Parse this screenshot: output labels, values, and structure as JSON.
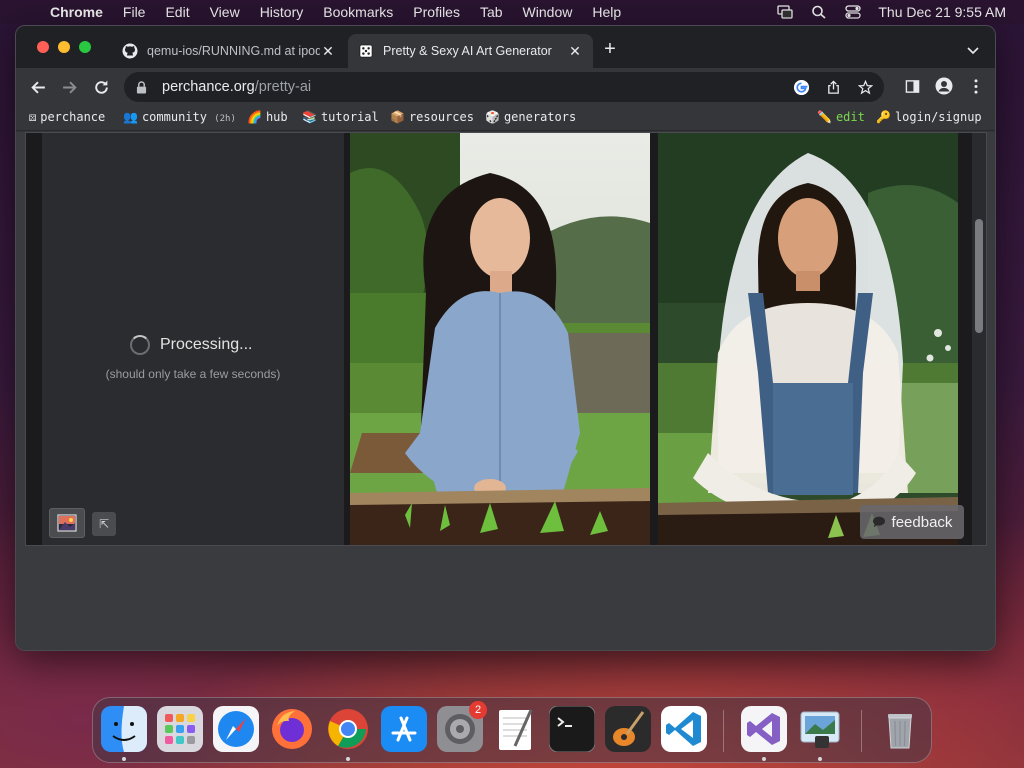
{
  "menubar": {
    "app_name": "Chrome",
    "items": [
      "File",
      "Edit",
      "View",
      "History",
      "Bookmarks",
      "Profiles",
      "Tab",
      "Window",
      "Help"
    ],
    "clock": "Thu Dec 21  9:55 AM"
  },
  "tabs": [
    {
      "title": "qemu-ios/RUNNING.md at ipod",
      "favicon": "github-icon"
    },
    {
      "title": "Pretty & Sexy AI Art Generator",
      "favicon": "dice-icon",
      "active": true
    }
  ],
  "address_bar": {
    "host": "perchance.org",
    "path": "/pretty-ai"
  },
  "bookmarks": [
    {
      "icon": "⚄",
      "label": "perchance"
    },
    {
      "icon": "👥",
      "label": "community",
      "note": "(2h)"
    },
    {
      "icon": "🌈",
      "label": "hub"
    },
    {
      "icon": "📚",
      "label": "tutorial"
    },
    {
      "icon": "📦",
      "label": "resources"
    },
    {
      "icon": "🎲",
      "label": "generators"
    }
  ],
  "bookmarks_right": [
    {
      "icon": "✏️",
      "label": "edit"
    },
    {
      "icon": "🔑",
      "label": "login/signup"
    }
  ],
  "page": {
    "processing_label": "Processing...",
    "processing_sub": "(should only take a few seconds)",
    "feedback_label": "feedback",
    "expand_glyph": "⇱"
  },
  "dock": {
    "apps": [
      "Finder",
      "Launchpad",
      "Safari",
      "Firefox",
      "Chrome",
      "App Store",
      "System Settings",
      "TextEdit",
      "Terminal",
      "GarageBand",
      "Visual Studio Code",
      "Visual Studio",
      "Preview",
      "Trash"
    ],
    "settings_badge": "2"
  },
  "colors": {
    "edit_link": "#7cd84c",
    "window_bg": "#35363a",
    "tabstrip_bg": "#202124"
  }
}
